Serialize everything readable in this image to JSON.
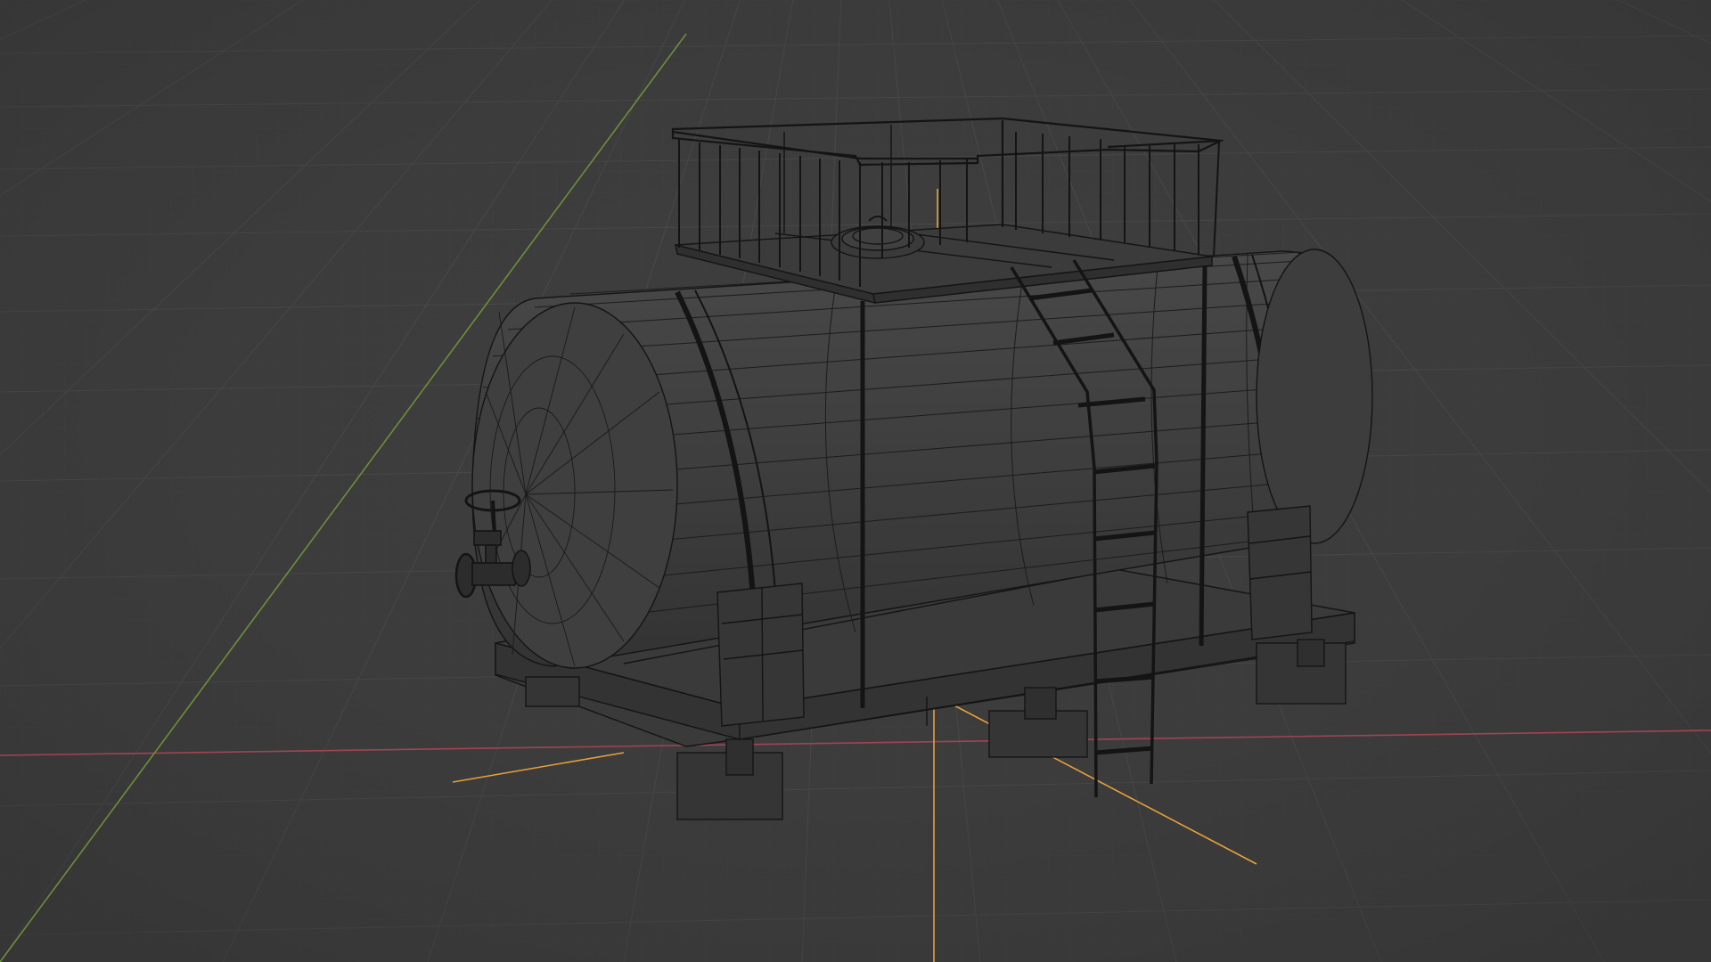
{
  "viewport": {
    "mode": "3D viewport",
    "shading": "wireframe",
    "overlays": {
      "grid_floor": true,
      "x_axis": true,
      "y_axis": true,
      "selection_outline": true
    },
    "colors": {
      "background": "#3d3d3d",
      "grid": "#4a4a4a",
      "x_axis": "#a04552",
      "y_axis": "#6d8f3a",
      "wire": "#141414",
      "surface": "#3b3b3b",
      "selection": "#e8a13a"
    },
    "scene_object": {
      "name": "tank-wagon-model",
      "parts": [
        "cylindrical-tank",
        "tank-end-cap",
        "top-platform",
        "guard-railing",
        "manhole-hatch",
        "side-ladder",
        "support-saddles",
        "base-frame",
        "side-valve"
      ]
    }
  }
}
